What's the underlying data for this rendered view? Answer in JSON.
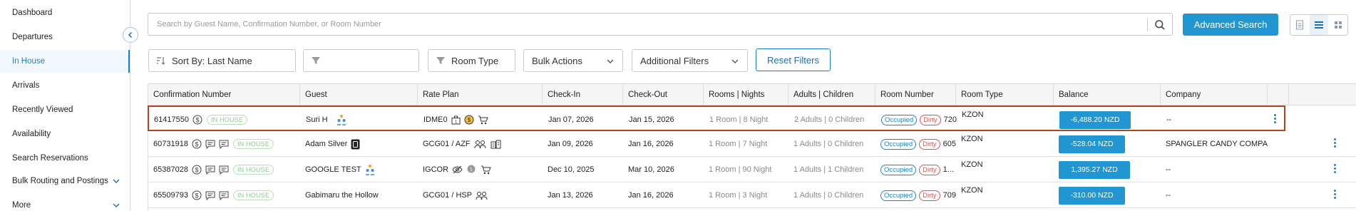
{
  "sidebar": {
    "items": [
      {
        "label": "Dashboard"
      },
      {
        "label": "Departures"
      },
      {
        "label": "In House",
        "active": true
      },
      {
        "label": "Arrivals"
      },
      {
        "label": "Recently Viewed"
      },
      {
        "label": "Availability"
      },
      {
        "label": "Search Reservations"
      },
      {
        "label": "Bulk Routing and Postings",
        "expandable": true
      },
      {
        "label": "More",
        "expandable": true
      }
    ],
    "collapse_icon": "chevron-left-icon"
  },
  "search": {
    "placeholder": "Search by Guest Name, Confirmation Number, or Room Number",
    "icon": "search-icon",
    "advanced_label": "Advanced Search"
  },
  "view_toggle": {
    "icons": [
      "document-view-icon",
      "list-view-icon",
      "grid-view-icon"
    ],
    "active_index": 1
  },
  "filters": {
    "sort_label": "Sort By: Last Name",
    "filter_value": "",
    "room_type_label": "Room Type",
    "bulk_actions_label": "Bulk Actions",
    "additional_filters_label": "Additional Filters",
    "reset_label": "Reset Filters"
  },
  "table": {
    "columns": [
      "Confirmation Number",
      "Guest",
      "Rate Plan",
      "Check-In",
      "Check-Out",
      "Rooms | Nights",
      "Adults | Children",
      "Room Number",
      "Room Type",
      "Balance",
      "Company"
    ],
    "status_label": "IN HOUSE",
    "occupied_label": "Occupied",
    "dirty_label": "Dirty",
    "rows": [
      {
        "confirmation": "61417550",
        "guest": "Suri H",
        "rate_plan": "IDME0",
        "check_in": "Jan 07, 2026",
        "check_out": "Jan 15, 2026",
        "rooms_nights": "1 Room | 8 Night",
        "adults_children": "2 Adults | 0 Children",
        "room_number": "720",
        "room_type": "KZON",
        "balance": "-6,488.20 NZD",
        "company": "--",
        "selected": true
      },
      {
        "confirmation": "60731918",
        "guest": "Adam Silver",
        "rate_plan": "GCG01 / AZF",
        "check_in": "Jan 09, 2026",
        "check_out": "Jan 16, 2026",
        "rooms_nights": "1 Room | 7 Night",
        "adults_children": "1 Adults | 0 Children",
        "room_number": "605",
        "room_type": "KZON",
        "balance": "-528.04 NZD",
        "company": "SPANGLER CANDY COMPANY"
      },
      {
        "confirmation": "65387028",
        "guest": "GOOGLE TEST",
        "rate_plan": "IGCOR",
        "check_in": "Dec 10, 2025",
        "check_out": "Mar 10, 2026",
        "rooms_nights": "1 Room | 90 Night",
        "adults_children": "1 Adults | 1 Children",
        "room_number": "1...",
        "room_type": "KZON",
        "balance": "1,395.27 NZD",
        "company": "--"
      },
      {
        "confirmation": "65509793",
        "guest": "Gabimaru the Hollow",
        "rate_plan": "GCG01 / HSP",
        "check_in": "Jan 13, 2026",
        "check_out": "Jan 16, 2026",
        "rooms_nights": "1 Room | 3 Night",
        "adults_children": "1 Adults | 0 Children",
        "room_number": "709",
        "room_type": "KZON",
        "balance": "-310.00 NZD",
        "company": "--"
      }
    ]
  },
  "colors": {
    "accent": "#2196d3",
    "selected_row_border": "#b0451d",
    "in_house_badge": "#8cc98c",
    "dirty": "#d9534f"
  }
}
